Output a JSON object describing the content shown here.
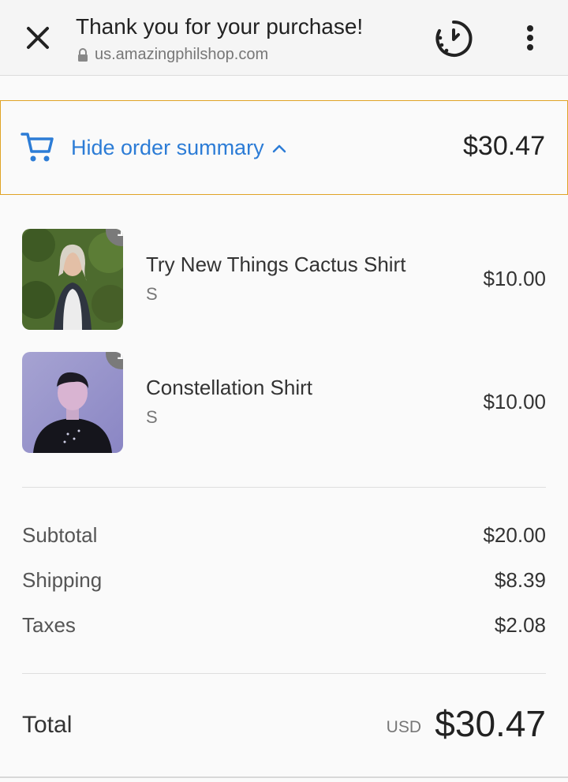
{
  "browser": {
    "title": "Thank you for your purchase!",
    "url": "us.amazingphilshop.com"
  },
  "summary_toggle": {
    "label": "Hide order summary",
    "total": "$30.47"
  },
  "items": [
    {
      "name": "Try New Things Cactus Shirt",
      "variant": "S",
      "price": "$10.00",
      "quantity": "1"
    },
    {
      "name": "Constellation Shirt",
      "variant": "S",
      "price": "$10.00",
      "quantity": "1"
    }
  ],
  "costs": {
    "subtotal_label": "Subtotal",
    "subtotal": "$20.00",
    "shipping_label": "Shipping",
    "shipping": "$8.39",
    "taxes_label": "Taxes",
    "taxes": "$2.08"
  },
  "total": {
    "label": "Total",
    "currency": "USD",
    "amount": "$30.47"
  },
  "colors": {
    "accent_link": "#2c7cd6",
    "toggle_border": "#e0a325"
  }
}
